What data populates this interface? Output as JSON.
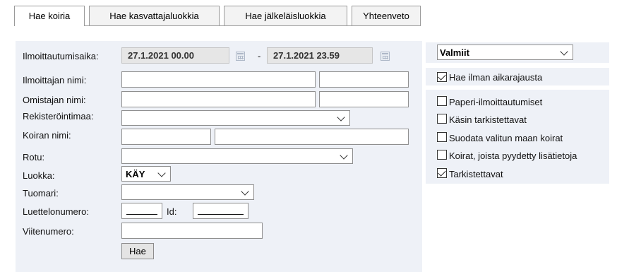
{
  "tabs": [
    {
      "label": "Hae koiria",
      "active": true
    },
    {
      "label": "Hae kasvattajaluokkia",
      "active": false
    },
    {
      "label": "Hae jälkeläisluokkia",
      "active": false
    },
    {
      "label": "Yhteenveto",
      "active": false
    }
  ],
  "form": {
    "ilmoittautumisaika_label": "Ilmoittautumisaika:",
    "date_from": "27.1.2021 00.00",
    "date_separator": "-",
    "date_to": "27.1.2021 23.59",
    "ilmoittajan_nimi_label": "Ilmoittajan nimi:",
    "omistajan_nimi_label": "Omistajan nimi:",
    "rekisterointimaa_label": "Rekisteröintimaa:",
    "koiran_nimi_label": "Koiran nimi:",
    "rotu_label": "Rotu:",
    "luokka_label": "Luokka:",
    "luokka_value": "KÄY",
    "tuomari_label": "Tuomari:",
    "luettelonumero_label": "Luettelonumero:",
    "id_label": "Id:",
    "viitenumero_label": "Viitenumero:",
    "hae_button": "Hae"
  },
  "side": {
    "status_select": "Valmiit",
    "hae_ilman_aikarajausta": {
      "label": "Hae ilman aikarajausta",
      "checked": true
    },
    "options": [
      {
        "label": "Paperi-ilmoittautumiset",
        "checked": false
      },
      {
        "label": "Käsin tarkistettavat",
        "checked": false
      },
      {
        "label": "Suodata valitun maan koirat",
        "checked": false
      },
      {
        "label": "Koirat, joista pyydetty lisätietoja",
        "checked": false
      },
      {
        "label": "Tarkistettavat",
        "checked": true
      }
    ]
  }
}
